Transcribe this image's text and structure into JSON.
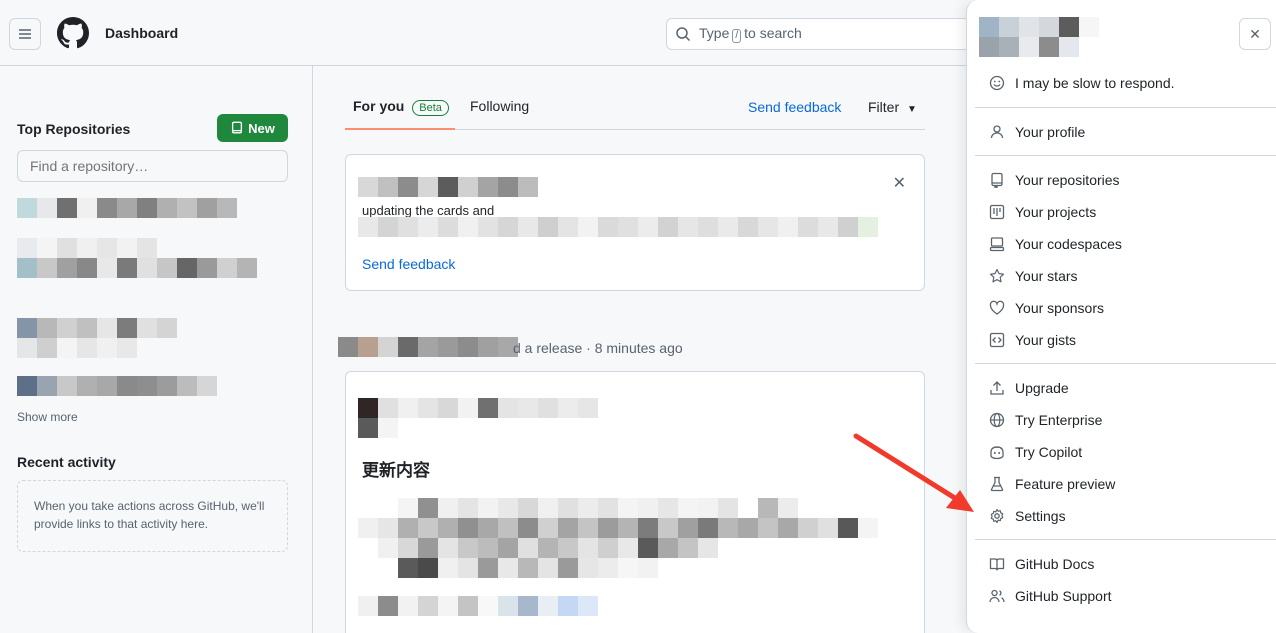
{
  "header": {
    "title": "Dashboard",
    "search_text": "Type / to search",
    "search_before": "Type",
    "search_key": "/",
    "search_after": "to search"
  },
  "sidebar": {
    "top_repos_title": "Top Repositories",
    "new_button": "New",
    "find_placeholder": "Find a repository…",
    "show_more": "Show more",
    "recent_title": "Recent activity",
    "recent_empty": "When you take actions across GitHub, we'll provide links to that activity here."
  },
  "feed": {
    "tab_for_you": "For you",
    "beta_badge": "Beta",
    "tab_following": "Following",
    "send_feedback": "Send feedback",
    "filter": "Filter",
    "card_fragment": "updating the cards and",
    "card_send_feedback": "Send feedback",
    "release_text": "d a release · 8 minutes ago",
    "release_heading": "更新内容"
  },
  "menu": {
    "status": "I may be slow to respond.",
    "items": [
      {
        "label": "Your profile",
        "icon": "person-icon"
      },
      {
        "label": "Your repositories",
        "icon": "repo-icon"
      },
      {
        "label": "Your projects",
        "icon": "project-icon"
      },
      {
        "label": "Your codespaces",
        "icon": "codespaces-icon"
      },
      {
        "label": "Your stars",
        "icon": "star-icon"
      },
      {
        "label": "Your sponsors",
        "icon": "heart-icon"
      },
      {
        "label": "Your gists",
        "icon": "code-square-icon"
      },
      {
        "label": "Upgrade",
        "icon": "upload-icon"
      },
      {
        "label": "Try Enterprise",
        "icon": "globe-icon"
      },
      {
        "label": "Try Copilot",
        "icon": "copilot-icon"
      },
      {
        "label": "Feature preview",
        "icon": "beaker-icon"
      },
      {
        "label": "Settings",
        "icon": "gear-icon"
      },
      {
        "label": "GitHub Docs",
        "icon": "book-icon"
      },
      {
        "label": "GitHub Support",
        "icon": "people-icon"
      }
    ]
  },
  "colors": {
    "accent_green": "#1f883d",
    "link_blue": "#0969da",
    "tab_underline": "#fd8c73",
    "annotation_arrow": "#f23a2c"
  }
}
